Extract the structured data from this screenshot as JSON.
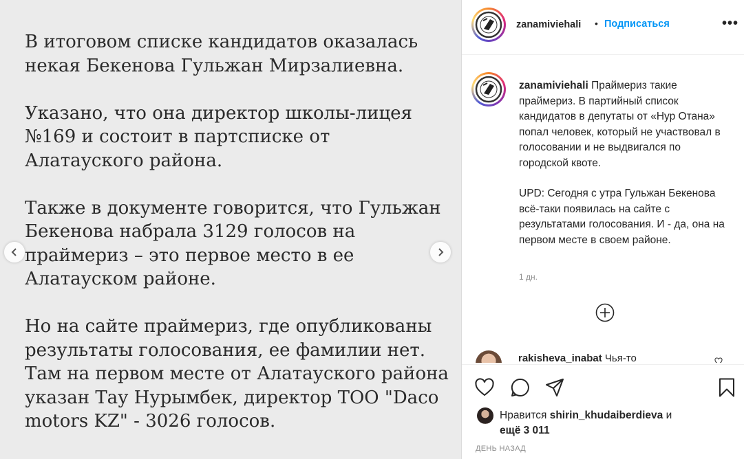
{
  "slide": {
    "paragraphs": [
      "В итоговом списке кандидатов оказалась\nнекая Бекенова Гульжан Мирзалиевна.",
      "Указано, что она директор школы-лицея\n№169 и состоит в партсписке от\nАлатауского района.",
      "Также в документе говорится, что Гульжан\nБекенова набрала 3129 голосов на\nпраймериз – это первое место в ее\nАлатауском районе.",
      "Но на сайте праймериз, где опубликованы\nрезультаты голосования, ее фамилии нет.\nТам на первом месте от Алатауского района\nуказан Тау Нурымбек, директор ТОО \"Daco\nmotors KZ\" - 3026 голосов."
    ],
    "prev_icon": "chevron-left-icon",
    "next_icon": "chevron-right-icon"
  },
  "header": {
    "username": "zanamiviehali",
    "dot": "•",
    "follow_label": "Подписаться",
    "more_label": "•••"
  },
  "caption": {
    "username": "zanamiviehali",
    "text": "Праймериз такие праймериз. В партийный список кандидатов в депутаты от «Нур Отана» попал человек, который не участвовал в голосовании и не выдвигался по городской квоте.",
    "update": "UPD: Сегодня с утра Гульжан Бекенова всё-таки появилась на сайте с результатами голосования. И - да, она на первом месте в своем районе.",
    "time": "1 дн."
  },
  "comment": {
    "username": "rakisheva_inabat",
    "text": "Чья-то"
  },
  "likes": {
    "prefix": "Нравится",
    "user": "shirin_khudaiberdieva",
    "conj": "и",
    "more": "ещё 3 011"
  },
  "post_date": "ДЕНЬ НАЗАД",
  "colors": {
    "accent": "#0095f6",
    "slide_bg": "#ebebeb",
    "text": "#262626",
    "muted": "#8e8e8e"
  }
}
